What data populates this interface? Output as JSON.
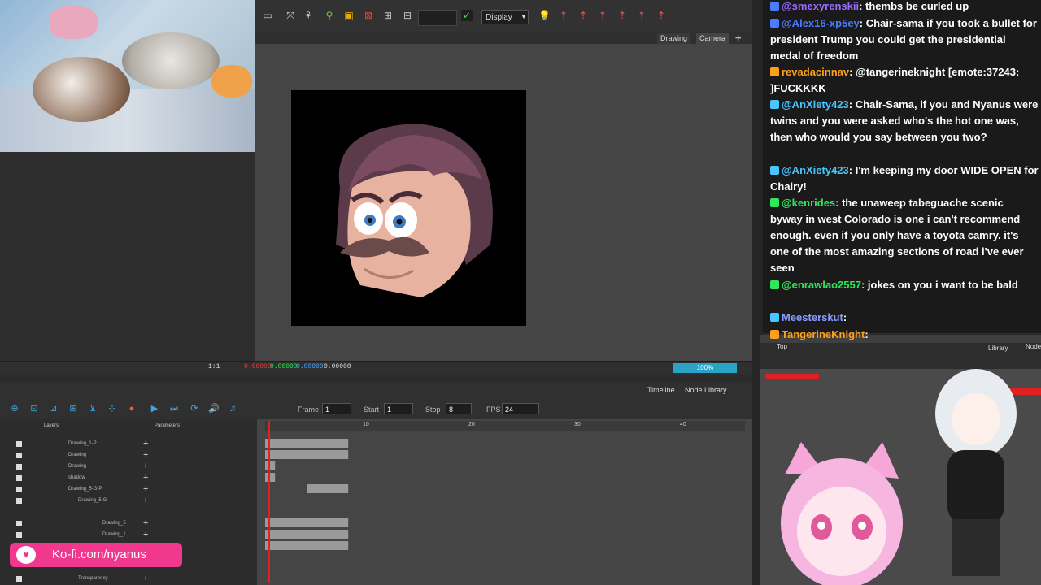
{
  "toolbar": {
    "display_value": "Display"
  },
  "view_tabs": {
    "drawing": "Drawing",
    "camera": "Camera"
  },
  "statusbar": {
    "zoom": "100%",
    "coord1": "0.00000",
    "coord2": "0.00000",
    "coord3": "0.00000",
    "coord4": "0.00000",
    "scale": "1:1"
  },
  "timeline": {
    "tab_timeline": "Timeline",
    "tab_node_library": "Node Library",
    "frame_label": "Frame",
    "frame_value": "1",
    "start_label": "Start",
    "start_value": "1",
    "stop_label": "Stop",
    "stop_value": "8",
    "fps_label": "FPS",
    "fps_value": "24",
    "ruler_ticks": [
      "10",
      "20",
      "30",
      "40"
    ]
  },
  "layers": {
    "header_layers": "Layers",
    "header_parameters": "Parameters",
    "rows": [
      "Drawing_1-P",
      "Drawing",
      "Drawing",
      "shadow",
      "Drawing_5-G-P",
      "Drawing_5-G",
      "Drawing_5",
      "Drawing_1",
      "Transparency"
    ]
  },
  "kofi": {
    "text": "Ko-fi.com/nyanus"
  },
  "chat": {
    "messages": [
      {
        "user": "@smexyrenskii",
        "text": ": thembs be curled up",
        "color": "#9c6bff"
      },
      {
        "user": "@Alex16-xp5ey",
        "text": ": Chair-sama if you took a bullet for president Trump you could get the presidential medal of freedom",
        "color": "#4b7bff"
      },
      {
        "user": "revadacinnav",
        "text": ": @tangerineknight [emote:37243: ]FUCKKKK",
        "color": "#ff9f1a"
      },
      {
        "user": "@AnXiety423",
        "text": ": Chair-Sama, if you and Nyanus were twins and you were asked who's the hot one was, then who would you say between you two?",
        "color": "#49c5ff"
      },
      {
        "user": "@AnXiety423",
        "text": ": I'm keeping my door WIDE OPEN for Chairy!",
        "color": "#49c5ff"
      },
      {
        "user": "@kenrides",
        "text": ": the unaweep tabeguache scenic byway in west Colorado is one i can't recommend enough. even if you only have a toyota camry. it's one of the most amazing sections of road i've ever seen",
        "color": "#2ee85a"
      },
      {
        "user": "@enrawlao2557",
        "text": ": jokes on you i want to be bald",
        "color": "#2ee85a"
      },
      {
        "user": "Meesterskut",
        "text": ":",
        "color": "#8a9bff"
      },
      {
        "user": "TangerineKnight",
        "text": ":",
        "color": "#ff9f1a"
      }
    ]
  },
  "nodeview": {
    "top_label": "Top",
    "library_label": "Library",
    "node_label": "Node"
  }
}
